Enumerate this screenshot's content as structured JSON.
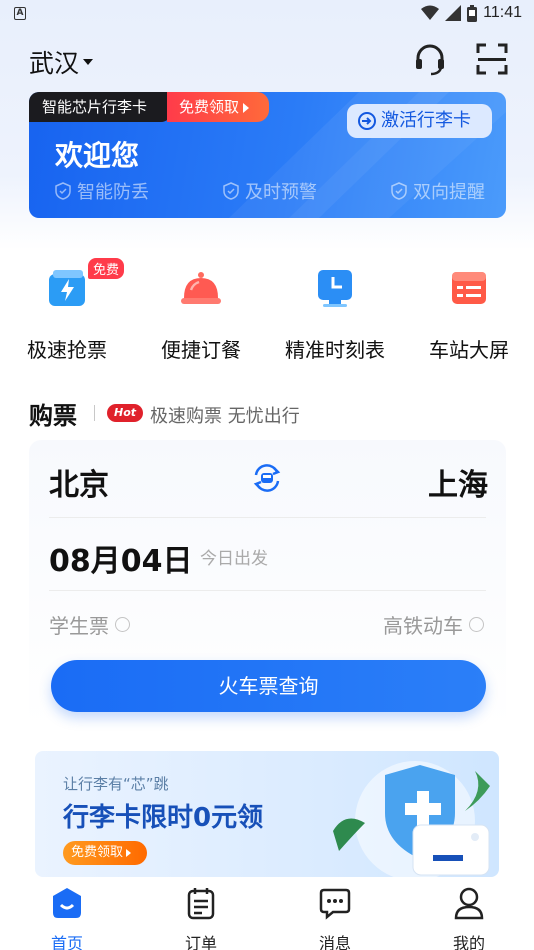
{
  "status_bar": {
    "time": "11:41",
    "left_icon_letter": "A"
  },
  "header": {
    "city": "武汉",
    "icons": [
      "headset-icon",
      "scan-icon"
    ]
  },
  "banner": {
    "tag": "智能芯片行李卡",
    "free_label": "免费领取",
    "activate_label": "激活行李卡",
    "welcome": "欢迎您",
    "features": [
      "智能防丢",
      "及时预警",
      "双向提醒"
    ]
  },
  "quick_menu": {
    "free_badge": "免费",
    "items": [
      {
        "label": "极速抢票",
        "icon": "flash-card-icon"
      },
      {
        "label": "便捷订餐",
        "icon": "food-cloche-icon"
      },
      {
        "label": "精准时刻表",
        "icon": "clock-monitor-icon"
      },
      {
        "label": "车站大屏",
        "icon": "station-board-icon"
      }
    ]
  },
  "buy_section": {
    "title": "购票",
    "hot": "Hot",
    "subtitle": "极速购票 无忧出行"
  },
  "ticket_card": {
    "from": "北京",
    "to": "上海",
    "date": "08月04日",
    "date_sub": "今日出发",
    "option_student": "学生票",
    "option_highspeed": "高铁动车",
    "search_label": "火车票查询"
  },
  "promo": {
    "subtitle": "让行李有“芯”跳",
    "title": "行李卡限时0元领",
    "button": "免费领取"
  },
  "tab_bar": {
    "items": [
      {
        "label": "首页",
        "icon": "home-icon",
        "active": true
      },
      {
        "label": "订单",
        "icon": "order-icon",
        "active": false
      },
      {
        "label": "消息",
        "icon": "message-icon",
        "active": false
      },
      {
        "label": "我的",
        "icon": "profile-icon",
        "active": false
      }
    ]
  },
  "colors": {
    "primary": "#1a6cf5",
    "hot": "#e0212b",
    "free": "#ff3b4a",
    "promo_btn": "#ff7a0a"
  }
}
